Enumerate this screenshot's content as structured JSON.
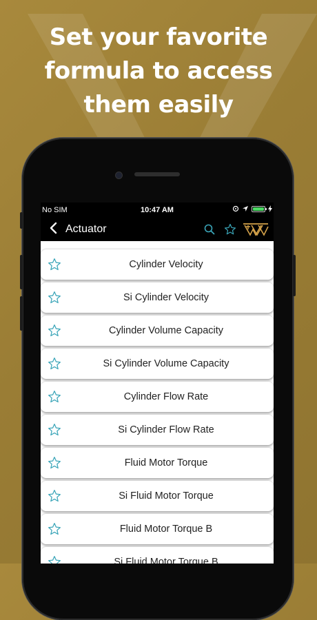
{
  "headline": {
    "line1": "Set your favorite",
    "line2": "formula to access",
    "line3": "them easily"
  },
  "status_bar": {
    "carrier": "No SIM",
    "time": "10:47 AM",
    "battery_level": 1.0
  },
  "nav": {
    "title": "Actuator",
    "icons": [
      "back-chevron-icon",
      "search-icon",
      "star-icon",
      "brand-logo"
    ]
  },
  "colors": {
    "background": "#9f8338",
    "accent": "#3aa5b8",
    "logo": "#d4a24a",
    "battery": "#4cd964"
  },
  "list": {
    "items": [
      {
        "label": "Cylinder Velocity"
      },
      {
        "label": "Si Cylinder Velocity"
      },
      {
        "label": "Cylinder Volume Capacity"
      },
      {
        "label": "Si Cylinder Volume Capacity"
      },
      {
        "label": "Cylinder Flow Rate"
      },
      {
        "label": "Si Cylinder Flow Rate"
      },
      {
        "label": "Fluid Motor Torque"
      },
      {
        "label": "Si Fluid Motor Torque"
      },
      {
        "label": "Fluid Motor Torque B"
      },
      {
        "label": "Si Fluid Motor Torque B"
      }
    ]
  }
}
